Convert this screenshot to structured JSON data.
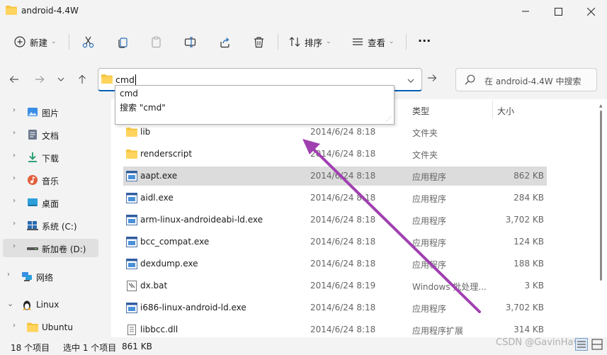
{
  "window": {
    "title": "android-4.4W"
  },
  "toolbar": {
    "new_label": "新建",
    "sort_label": "排序",
    "view_label": "查看",
    "more_label": "···"
  },
  "address": {
    "value": "cmd"
  },
  "search": {
    "placeholder": "在 android-4.4W 中搜索"
  },
  "suggestions": {
    "item1": "cmd",
    "item2": "搜索 \"cmd\""
  },
  "sidebar": {
    "items": [
      {
        "label": "图片",
        "icon": "pictures-icon"
      },
      {
        "label": "文档",
        "icon": "documents-icon"
      },
      {
        "label": "下载",
        "icon": "downloads-icon"
      },
      {
        "label": "音乐",
        "icon": "music-icon"
      },
      {
        "label": "桌面",
        "icon": "desktop-icon"
      },
      {
        "label": "系统 (C:)",
        "icon": "drive-icon"
      },
      {
        "label": "新加卷 (D:)",
        "icon": "drive-icon"
      },
      {
        "label": "网络",
        "icon": "network-icon"
      },
      {
        "label": "Linux",
        "icon": "linux-icon"
      },
      {
        "label": "Ubuntu",
        "icon": "folder-icon"
      }
    ]
  },
  "columns": {
    "type": "类型",
    "size": "大小"
  },
  "files": [
    {
      "name": "lib",
      "date": "2014/6/24 8:18",
      "type": "文件夹",
      "size": "",
      "icon": "folder"
    },
    {
      "name": "renderscript",
      "date": "2014/6/24 8:18",
      "type": "文件夹",
      "size": "",
      "icon": "folder"
    },
    {
      "name": "aapt.exe",
      "date": "2014/6/24 8:18",
      "type": "应用程序",
      "size": "862 KB",
      "icon": "exe"
    },
    {
      "name": "aidl.exe",
      "date": "2014/6/24 8:18",
      "type": "应用程序",
      "size": "284 KB",
      "icon": "exe"
    },
    {
      "name": "arm-linux-androideabi-ld.exe",
      "date": "2014/6/24 8:18",
      "type": "应用程序",
      "size": "3,702 KB",
      "icon": "exe"
    },
    {
      "name": "bcc_compat.exe",
      "date": "2014/6/24 8:18",
      "type": "应用程序",
      "size": "124 KB",
      "icon": "exe"
    },
    {
      "name": "dexdump.exe",
      "date": "2014/6/24 8:18",
      "type": "应用程序",
      "size": "188 KB",
      "icon": "exe"
    },
    {
      "name": "dx.bat",
      "date": "2014/6/24 8:19",
      "type": "Windows 批处理...",
      "size": "3 KB",
      "icon": "bat"
    },
    {
      "name": "i686-linux-android-ld.exe",
      "date": "2014/6/24 8:18",
      "type": "应用程序",
      "size": "3,702 KB",
      "icon": "exe"
    },
    {
      "name": "libbcc.dll",
      "date": "2014/6/24 8:18",
      "type": "应用程序扩展",
      "size": "314 KB",
      "icon": "dll"
    }
  ],
  "status": {
    "count": "18 个项目",
    "selected": "选中 1 个项目",
    "selsize": "861 KB"
  },
  "watermark": "CSDN @GavinHavio",
  "colors": {
    "accent": "#005fb8",
    "folder": "#f5c542",
    "annotation": "#a040b0"
  }
}
